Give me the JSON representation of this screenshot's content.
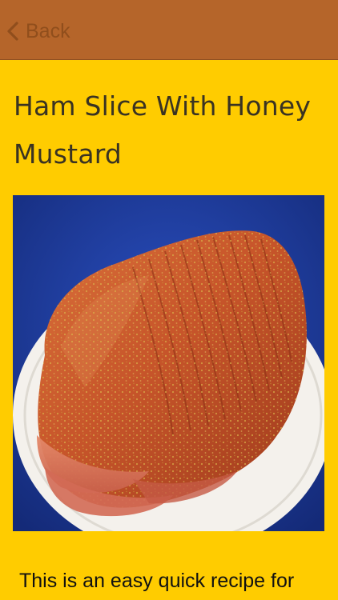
{
  "nav": {
    "back_label": "Back",
    "back_icon": "chevron-left-icon",
    "bar_color": "#B5652A"
  },
  "recipe": {
    "title": "Ham Slice With Honey Mustard",
    "description": "This is an easy quick recipe for",
    "background_color": "#FFCC00"
  }
}
